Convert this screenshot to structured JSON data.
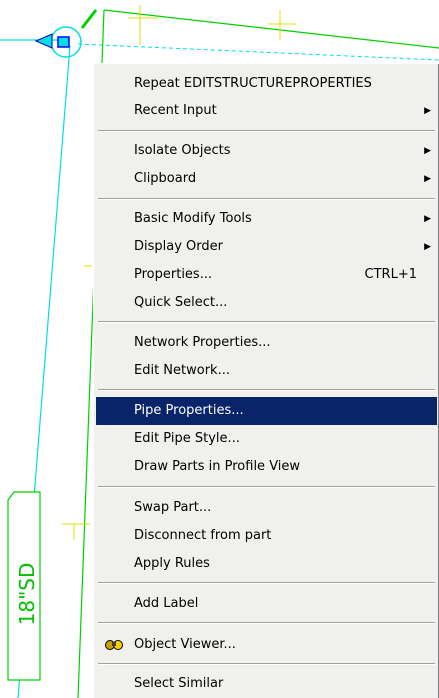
{
  "context_menu": {
    "items": [
      {
        "label": "Repeat EDITSTRUCTUREPROPERTIES",
        "submenu": false
      },
      {
        "label": "Recent Input",
        "submenu": true
      },
      {
        "label": "Isolate Objects",
        "submenu": true
      },
      {
        "label": "Clipboard",
        "submenu": true
      },
      {
        "label": "Basic Modify Tools",
        "submenu": true
      },
      {
        "label": "Display Order",
        "submenu": true
      },
      {
        "label": "Properties...",
        "shortcut": "CTRL+1",
        "submenu": false
      },
      {
        "label": "Quick Select...",
        "submenu": false
      },
      {
        "label": "Network Properties...",
        "submenu": false
      },
      {
        "label": "Edit Network...",
        "submenu": false
      },
      {
        "label": "Pipe Properties...",
        "submenu": false,
        "highlighted": true
      },
      {
        "label": "Edit Pipe Style...",
        "submenu": false
      },
      {
        "label": "Draw Parts in Profile View",
        "submenu": false
      },
      {
        "label": "Swap Part...",
        "submenu": false
      },
      {
        "label": "Disconnect from part",
        "submenu": false
      },
      {
        "label": "Apply Rules",
        "submenu": false
      },
      {
        "label": "Add Label",
        "submenu": false
      },
      {
        "label": "Object Viewer...",
        "submenu": false,
        "icon": "object-viewer-icon"
      },
      {
        "label": "Select Similar",
        "submenu": false
      }
    ]
  },
  "drawing": {
    "pipe_label": "18\"SD",
    "colors": {
      "pipe": "#00e0e0",
      "parcel_line": "#00d000",
      "crosshair": "#e0e000",
      "highlight": "#0a246a"
    }
  }
}
